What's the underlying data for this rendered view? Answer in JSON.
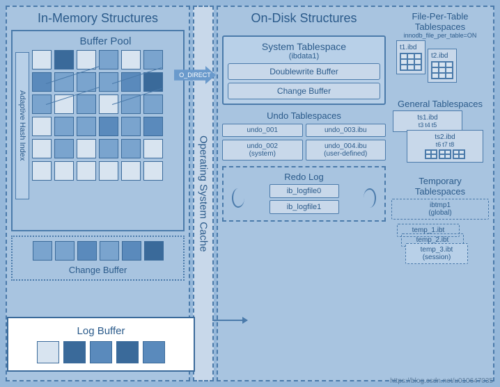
{
  "in_memory": {
    "title": "In-Memory Structures",
    "buffer_pool": "Buffer Pool",
    "ahi": "Adaptive Hash Index",
    "change_buffer": "Change Buffer"
  },
  "os_cache": "Operating System Cache",
  "o_direct": "O_DIRECT",
  "on_disk": {
    "title": "On-Disk Structures",
    "system_tablespace": {
      "title": "System Tablespace",
      "sub": "(ibdata1)",
      "dw": "Doublewrite Buffer",
      "cb": "Change Buffer"
    },
    "undo": {
      "title": "Undo Tablespaces",
      "u1": "undo_001",
      "u2": "undo_002\n(system)",
      "u3": "undo_003.ibu",
      "u4": "undo_004.ibu\n(user-defined)"
    },
    "redo": {
      "title": "Redo Log",
      "f1": "ib_logfile0",
      "f2": "ib_logfile1"
    },
    "fpt": {
      "title": "File-Per-Table\nTablespaces",
      "opt": "innodb_file_per_table=ON",
      "t1": "t1.ibd",
      "t2": "t2.ibd"
    },
    "gts": {
      "title": "General Tablespaces",
      "ts1": "ts1.ibd",
      "ts2": "ts2.ibd",
      "l1": "t3",
      "l2": "t4",
      "l3": "t5",
      "l4": "t6",
      "l5": "t7",
      "l6": "t8"
    },
    "temp": {
      "title": "Temporary\nTablespaces",
      "g": "ibtmp1\n(global)",
      "s1": "temp_1.ibt",
      "s2": "temp_2.ibt",
      "s3": "temp_3.ibt\n(session)"
    }
  },
  "log_buffer": "Log Buffer",
  "watermark": "https://blog.csdn.net/u010647035"
}
